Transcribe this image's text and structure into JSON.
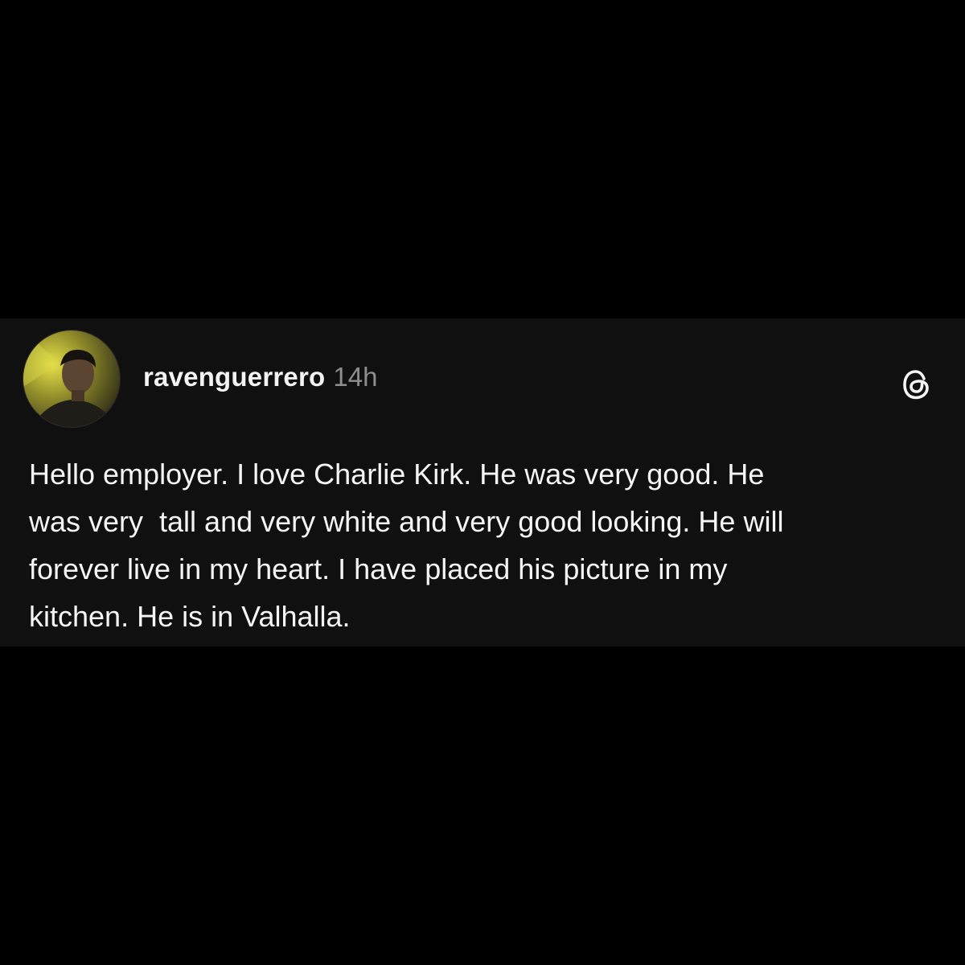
{
  "post": {
    "username": "ravenguerrero",
    "timestamp": "14h",
    "avatar_icon": "profile-photo",
    "brand_icon": "threads-logo-icon",
    "text": "Hello employer. I love Charlie Kirk. He was very good. He\nwas very  tall and very white and very good looking. He will\nforever live in my heart. I have placed his picture in my\nkitchen. He is in Valhalla."
  },
  "colors": {
    "page_background": "#000000",
    "card_background": "#101010",
    "text_primary": "#f5f5f5",
    "text_secondary": "#8e8e8e"
  }
}
